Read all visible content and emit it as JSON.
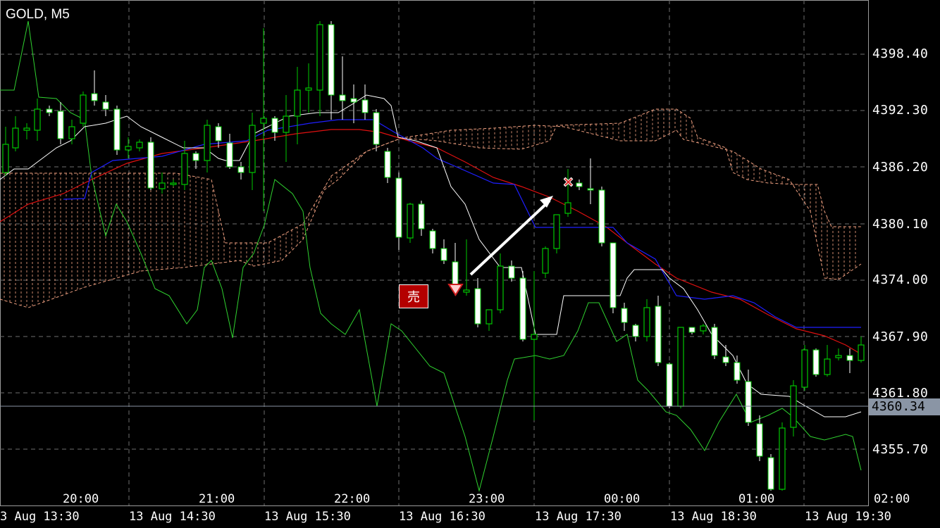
{
  "header": {
    "symbol": "GOLD, M5"
  },
  "price_axis": {
    "ticks": [
      "4398.40",
      "4392.30",
      "4386.20",
      "4380.10",
      "4374.00",
      "4367.90",
      "4361.80",
      "4355.70"
    ],
    "current_price": "4360.34"
  },
  "time_axis": {
    "hours": [
      "20:00",
      "21:00",
      "22:00",
      "23:00",
      "00:00",
      "01:00",
      "02:00"
    ],
    "dates": [
      "3 Aug 13:30",
      "13 Aug 14:30",
      "13 Aug 15:30",
      "13 Aug 16:30",
      "13 Aug 17:30",
      "13 Aug 18:30",
      "13 Aug 19:30"
    ]
  },
  "markers": {
    "sell_label": "売"
  },
  "colors": {
    "background": "#000000",
    "grid": "#6e6e6e",
    "bull_candle": "#00c800",
    "bear_candle": "#ffffff",
    "chikou": "#2fd12f",
    "kijun": "#ffffff",
    "tenkan": "#1f1fff",
    "ma": "#e01010",
    "kumo": "#f0a080",
    "current_price_line": "#8a95a5"
  },
  "icons": [
    "sell-arrow-icon",
    "close-x-icon",
    "trend-arrow-icon"
  ]
}
